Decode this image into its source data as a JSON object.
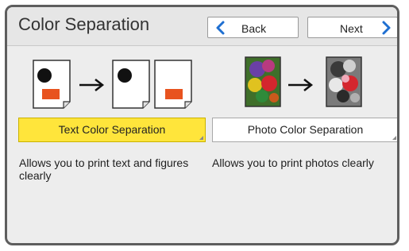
{
  "header": {
    "title": "Color Separation",
    "back_label": "Back",
    "next_label": "Next"
  },
  "options": [
    {
      "label": "Text Color Separation",
      "description": "Allows you to print text and figures clearly",
      "selected": true
    },
    {
      "label": "Photo Color Separation",
      "description": "Allows you to print photos clearly",
      "selected": false
    }
  ],
  "colors": {
    "selected_bg": "#ffe53b",
    "accent_blue": "#1f6fd1",
    "marker_red": "#e8531f"
  }
}
